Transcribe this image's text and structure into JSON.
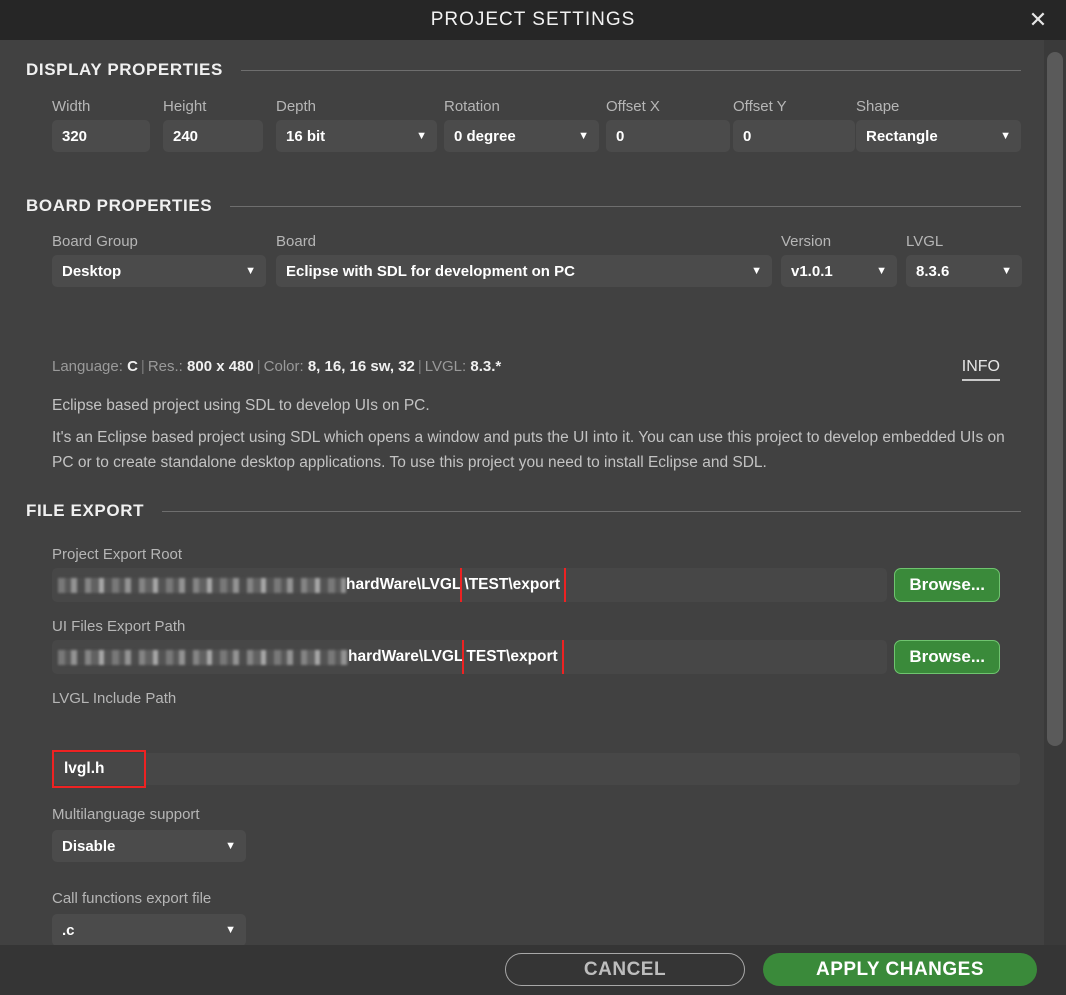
{
  "window": {
    "title": "PROJECT SETTINGS",
    "close_icon": "close-icon"
  },
  "sections": {
    "display": {
      "title": "DISPLAY PROPERTIES"
    },
    "board": {
      "title": "BOARD PROPERTIES"
    },
    "file_export": {
      "title": "FILE EXPORT"
    }
  },
  "display_properties": {
    "width": {
      "label": "Width",
      "value": "320"
    },
    "height": {
      "label": "Height",
      "value": "240"
    },
    "depth": {
      "label": "Depth",
      "value": "16 bit"
    },
    "rotation": {
      "label": "Rotation",
      "value": "0 degree"
    },
    "offset_x": {
      "label": "Offset X",
      "value": "0"
    },
    "offset_y": {
      "label": "Offset Y",
      "value": "0"
    },
    "shape": {
      "label": "Shape",
      "value": "Rectangle"
    }
  },
  "board_properties": {
    "board_group": {
      "label": "Board Group",
      "value": "Desktop"
    },
    "board": {
      "label": "Board",
      "value": "Eclipse with SDL for development on PC"
    },
    "version": {
      "label": "Version",
      "value": "v1.0.1"
    },
    "lvgl": {
      "label": "LVGL",
      "value": "8.3.6"
    },
    "info": {
      "language_key": "Language:",
      "language_value": "C",
      "res_key": "Res.:",
      "res_value": "800 x 480",
      "color_key": "Color:",
      "color_value": "8, 16, 16 sw, 32",
      "lvgl_key": "LVGL:",
      "lvgl_value": "8.3.*",
      "separator": "|"
    },
    "info_link": "INFO",
    "description_short": "Eclipse based project using SDL to develop UIs on PC.",
    "description_long": "It's an Eclipse based project using SDL which opens a window and puts the UI into it. You can use this project to develop embedded UIs on PC or to create standalone desktop applications. To use this project you need to install Eclipse and SDL."
  },
  "file_export": {
    "project_export_root": {
      "label": "Project Export Root",
      "value_redacted_prefix": "",
      "value_visible": "hardWare\\LVGL",
      "value_highlighted": "\\TEST\\export",
      "browse_label": "Browse..."
    },
    "ui_files_export_path": {
      "label": "UI Files Export Path",
      "value_redacted_prefix": "",
      "value_visible": "hardWare\\LVGL",
      "value_highlighted": "TEST\\export",
      "browse_label": "Browse..."
    },
    "lvgl_include_path": {
      "label": "LVGL Include Path",
      "value": "lvgl.h"
    },
    "multilanguage_support": {
      "label": "Multilanguage support",
      "value": "Disable"
    },
    "call_functions_export_file": {
      "label": "Call functions export file",
      "value": ".c"
    }
  },
  "footer": {
    "cancel_label": "CANCEL",
    "apply_label": "APPLY CHANGES"
  },
  "colors": {
    "accent_green": "#3a8a3a",
    "highlight_red": "#ee2222",
    "panel_bg": "#414141",
    "titlebar_bg": "#262626",
    "field_bg": "#4b4b4b"
  },
  "icons": {
    "caret": "▼",
    "close": "✕"
  }
}
